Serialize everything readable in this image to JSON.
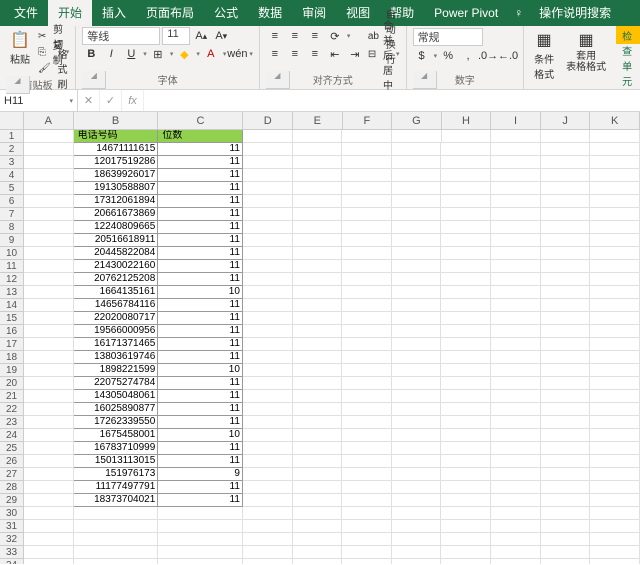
{
  "tabs": {
    "file": "文件",
    "home": "开始",
    "insert": "插入",
    "layout": "页面布局",
    "formulas": "公式",
    "data": "数据",
    "review": "审阅",
    "view": "视图",
    "help": "帮助",
    "powerpivot": "Power Pivot",
    "tell_me": "操作说明搜索"
  },
  "ribbon": {
    "clipboard": {
      "paste": "粘贴",
      "cut": "剪切",
      "copy": "复制",
      "format_painter": "格式刷",
      "label": "剪贴板"
    },
    "font": {
      "name": "等线",
      "size": "11",
      "label": "字体"
    },
    "align": {
      "wrap": "自动换行",
      "merge": "合并后居中",
      "label": "对齐方式"
    },
    "number": {
      "format": "常规",
      "label": "数字"
    },
    "styles": {
      "cond": "条件格式",
      "table": "套用\n表格格式",
      "label": ""
    },
    "check_cell": "检查单元"
  },
  "namebox": "H11",
  "columns": [
    "A",
    "B",
    "C",
    "D",
    "E",
    "F",
    "G",
    "H",
    "I",
    "J",
    "K"
  ],
  "headers": {
    "phone": "电话号码",
    "digits": "位数"
  },
  "rows": [
    {
      "phone": "14671111615",
      "digits": 11
    },
    {
      "phone": "12017519286",
      "digits": 11
    },
    {
      "phone": "18639926017",
      "digits": 11
    },
    {
      "phone": "19130588807",
      "digits": 11
    },
    {
      "phone": "17312061894",
      "digits": 11
    },
    {
      "phone": "20661673869",
      "digits": 11
    },
    {
      "phone": "12240809665",
      "digits": 11
    },
    {
      "phone": "20516618911",
      "digits": 11
    },
    {
      "phone": "20445822084",
      "digits": 11
    },
    {
      "phone": "21430022160",
      "digits": 11
    },
    {
      "phone": "20762125208",
      "digits": 11
    },
    {
      "phone": "1664135161",
      "digits": 10
    },
    {
      "phone": "14656784116",
      "digits": 11
    },
    {
      "phone": "22020080717",
      "digits": 11
    },
    {
      "phone": "19566000956",
      "digits": 11
    },
    {
      "phone": "16171371465",
      "digits": 11
    },
    {
      "phone": "13803619746",
      "digits": 11
    },
    {
      "phone": "1898221599",
      "digits": 10
    },
    {
      "phone": "22075274784",
      "digits": 11
    },
    {
      "phone": "14305048061",
      "digits": 11
    },
    {
      "phone": "16025890877",
      "digits": 11
    },
    {
      "phone": "17262339550",
      "digits": 11
    },
    {
      "phone": "1675458001",
      "digits": 10
    },
    {
      "phone": "16783710999",
      "digits": 11
    },
    {
      "phone": "15013113015",
      "digits": 11
    },
    {
      "phone": "151976173",
      "digits": 9
    },
    {
      "phone": "11177497791",
      "digits": 11
    },
    {
      "phone": "18373704021",
      "digits": 11
    }
  ],
  "total_rows": 34
}
